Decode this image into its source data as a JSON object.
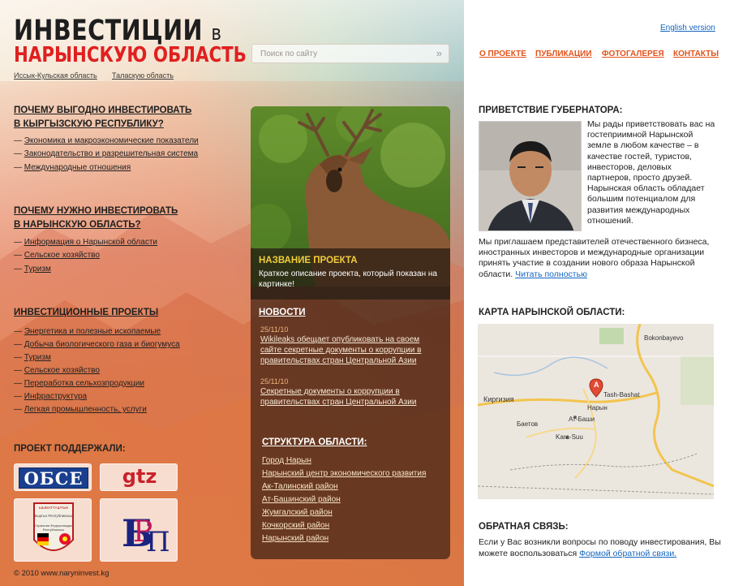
{
  "header": {
    "logo_line1": "ИНВЕСТИЦИИ",
    "logo_v": "в",
    "logo_line2": "НАРЫНСКУЮ ОБЛАСТЬ",
    "region_links": [
      "Иссык-Кульская область",
      "Таласкую область"
    ],
    "search_placeholder": "Поиск по сайту",
    "search_go": "»",
    "english": "English version",
    "nav": [
      "О ПРОЕКТЕ",
      "ПУБЛИКАЦИИ",
      "ФОТОГАЛЕРЕЯ",
      "КОНТАКТЫ"
    ]
  },
  "left": {
    "sections": [
      {
        "title_l1": "ПОЧЕМУ ВЫГОДНО ИНВЕСТИРОВАТЬ",
        "title_l2": "В КЫРГЫЗСКУЮ РЕСПУБЛИКУ?",
        "items": [
          "Экономика и макроэкономические показатели",
          "Законодательство и разрешительная система",
          "Международные отношения"
        ]
      },
      {
        "title_l1": "ПОЧЕМУ НУЖНО ИНВЕСТИРОВАТЬ",
        "title_l2": "В НАРЫНСКУЮ ОБЛАСТЬ?",
        "items": [
          "Информация о Нарынской области",
          "Сельское хозяйство",
          "Туризм"
        ]
      },
      {
        "title_l1": "ИНВЕСТИЦИОННЫЕ ПРОЕКТЫ",
        "title_l2": "",
        "items": [
          "Энергетика и полезные ископаемые",
          "Добыча биологического газа и биогумуса",
          "Туризм",
          "Сельское хозяйство",
          "Переработка сельхозпродукции",
          "Инфраструктура",
          "Легкая промышленность, услуги"
        ]
      }
    ],
    "sponsors_title": "ПРОЕКТ ПОДДЕРЖАЛИ:",
    "sponsors": {
      "osce": "ОБСЕ",
      "gtz": "gtz",
      "emblem_top": "ЫЫМАТТАШТЫК",
      "emblem_mid": "Кыргыз Республикасы",
      "emblem_bot": "Германия Федеративдик Республикасы",
      "letters": "БРП"
    },
    "copyright": "© 2010 www.naryninvest.kg"
  },
  "card": {
    "project_title": "НАЗВАНИЕ ПРОЕКТА",
    "project_text": "Краткое описание проекта,  который показан на картинке!",
    "news_title": "НОВОСТИ",
    "news": [
      {
        "date": "25/11/10",
        "text": "Wikileaks обещает опубликовать на своем сайте секретные документы о коррупции в правительствах стран Центральной Азии"
      },
      {
        "date": "25/11/10",
        "text": "Секретные документы о коррупции в правительствах стран Центральной Азии"
      }
    ],
    "structure_title": "СТРУКТУРА ОБЛАСТИ:",
    "structure": [
      "Город Нарын",
      "Нарынский центр экономического развития",
      "Ак-Талинский район",
      "Ат-Башинский район",
      "Жумгалский район",
      "Кочкорский район",
      "Нарынский район"
    ]
  },
  "right": {
    "governor_title": "ПРИВЕТСТВИЕ ГУБЕРНАТОРА:",
    "governor_text": "Мы рады приветствовать вас на гостеприимной Нарынской земле в любом качестве – в качестве гостей, туристов, инвесторов, деловых партнеров, просто друзей. Нарынская область обладает большим потенциалом для развития международных отношений.",
    "governor_text2": "Мы приглашаем представителей отечественного бизнеса, иностранных инвесторов и международные организации принять участие в создании нового образа Нарынской области.",
    "read_more": "Читать полностью",
    "map_title": "КАРТА НАРЫНСКОЙ ОБЛАСТИ:",
    "map_labels": {
      "a": "Bokonbayevo",
      "b": "Tash-Bashat",
      "c": "Киргизия",
      "d": "Нарын",
      "e": "Баетов",
      "f": "Ат-Баши",
      "g": "Kara-Suu",
      "marker": "A"
    },
    "feedback_title": "ОБРАТНАЯ СВЯЗЬ:",
    "feedback_text": "Если у Вас  возникли вопросы по поводу инвестирования, Вы можете воспользоваться",
    "feedback_link": "Формой обратной связи."
  },
  "colors": {
    "accent_red": "#e02020",
    "nav_orange": "#e2531b",
    "link_blue": "#1565c0",
    "caption_yellow": "#f2cd3c"
  }
}
